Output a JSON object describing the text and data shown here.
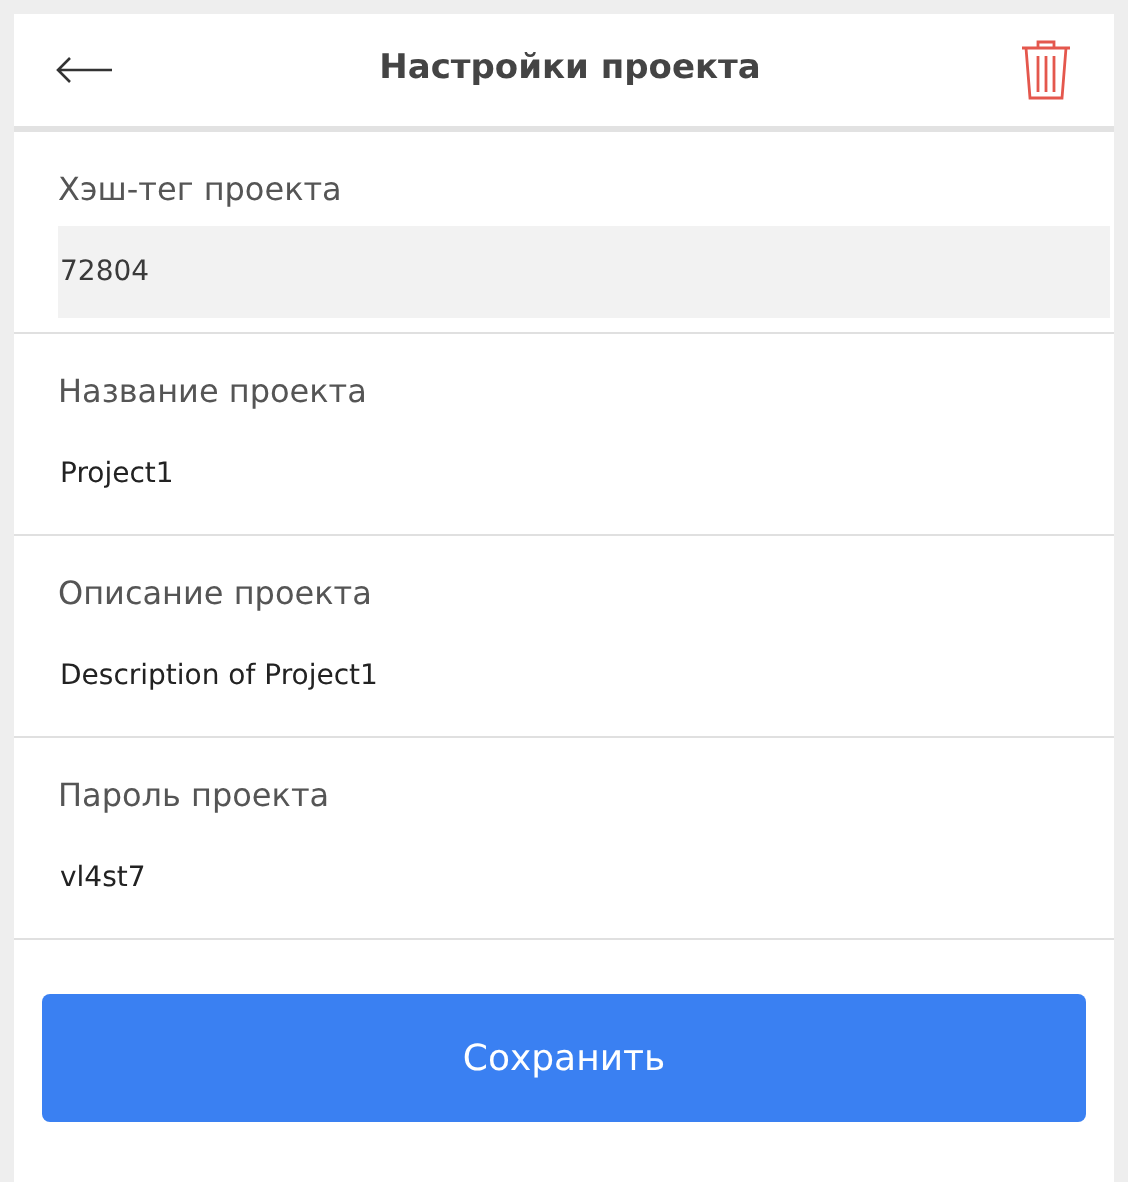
{
  "header": {
    "title": "Настройки проекта"
  },
  "fields": [
    {
      "label": "Хэш-тег проекта",
      "value": "72804",
      "readonly": true
    },
    {
      "label": "Название проекта",
      "value": "Project1",
      "readonly": false
    },
    {
      "label": "Описание проекта",
      "value": "Description of Project1",
      "readonly": false
    },
    {
      "label": "Пароль проекта",
      "value": "vl4st7",
      "readonly": false
    }
  ],
  "save_button": "Сохранить"
}
